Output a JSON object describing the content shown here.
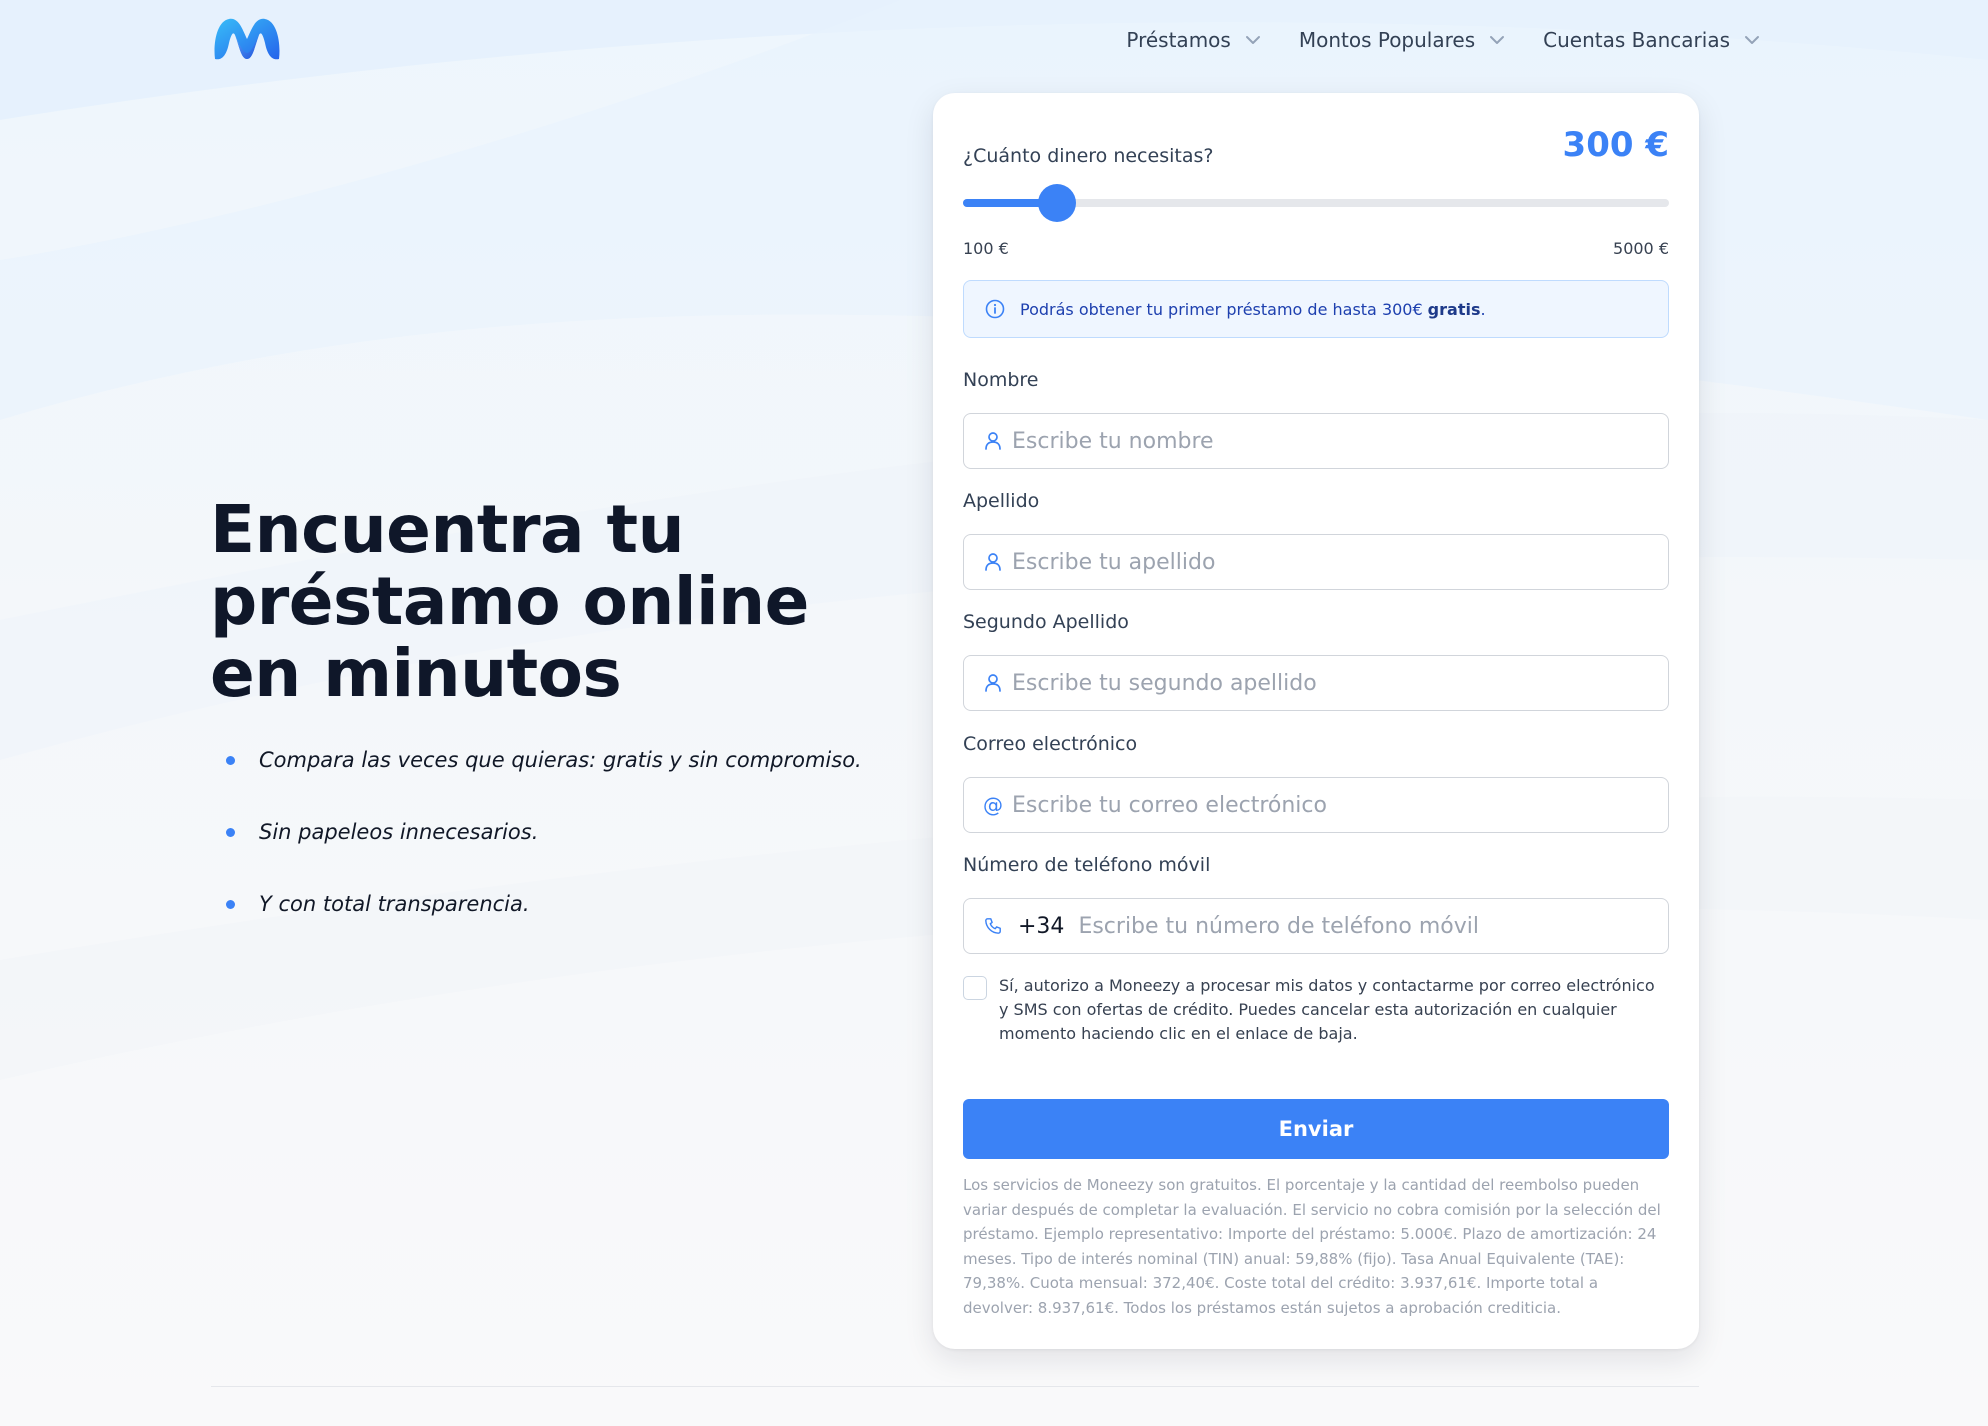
{
  "nav": {
    "items": [
      {
        "label": "Préstamos"
      },
      {
        "label": "Montos Populares"
      },
      {
        "label": "Cuentas Bancarias"
      }
    ]
  },
  "hero": {
    "title": "Encuentra tu préstamo online en minutos",
    "bullets": [
      "Compara las veces que quieras: gratis y sin compromiso.",
      "Sin papeleos innecesarios.",
      "Y con total transparencia."
    ]
  },
  "form": {
    "amount_question": "¿Cuánto dinero necesitas?",
    "amount_value": "300 €",
    "slider": {
      "min_label": "100 €",
      "max_label": "5000 €",
      "min": 100,
      "max": 5000,
      "value": 300
    },
    "info_text": "Podrás obtener tu primer préstamo de hasta 300€",
    "info_bold": "gratis",
    "info_suffix": ".",
    "fields": {
      "nombre": {
        "label": "Nombre",
        "placeholder": "Escribe tu nombre",
        "value": ""
      },
      "apellido": {
        "label": "Apellido",
        "placeholder": "Escribe tu apellido",
        "value": ""
      },
      "segundo_apellido": {
        "label": "Segundo Apellido",
        "placeholder": "Escribe tu segundo apellido",
        "value": ""
      },
      "correo": {
        "label": "Correo electrónico",
        "placeholder": "Escribe tu correo electrónico",
        "value": ""
      },
      "telefono": {
        "label": "Número de teléfono móvil",
        "prefix": "+34",
        "placeholder": "Escribe tu número de teléfono móvil",
        "value": ""
      }
    },
    "consent_text": "Sí, autorizo a Moneezy a procesar mis datos y contactarme por correo electrónico y SMS con ofertas de crédito. Puedes cancelar esta autorización en cualquier momento haciendo clic en el enlace de baja.",
    "consent_checked": false,
    "submit_label": "Enviar",
    "disclaimer": "Los servicios de Moneezy son gratuitos. El porcentaje y la cantidad del reembolso pueden variar después de completar la evaluación. El servicio no cobra comisión por la selección del préstamo. Ejemplo representativo: Importe del préstamo: 5.000€. Plazo de amortización: 24 meses. Tipo de interés nominal (TIN) anual: 59,88% (fijo). Tasa Anual Equivalente (TAE): 79,38%. Cuota mensual: 372,40€. Coste total del crédito: 3.937,61€. Importe total a devolver: 8.937,61€. Todos los préstamos están sujetos a aprobación crediticia."
  },
  "icons": {
    "logo": "moneezy-logo-icon",
    "nav_chevron": "chevron-down-icon",
    "info": "info-circle-icon",
    "user": "user-icon",
    "email": "at-sign-icon",
    "phone": "phone-icon"
  },
  "colors": {
    "accent": "#3b82f6",
    "title": "#0f1729",
    "info_bg": "#eff6ff",
    "info_border": "#bfdbfe",
    "placeholder": "#9ca3af"
  }
}
